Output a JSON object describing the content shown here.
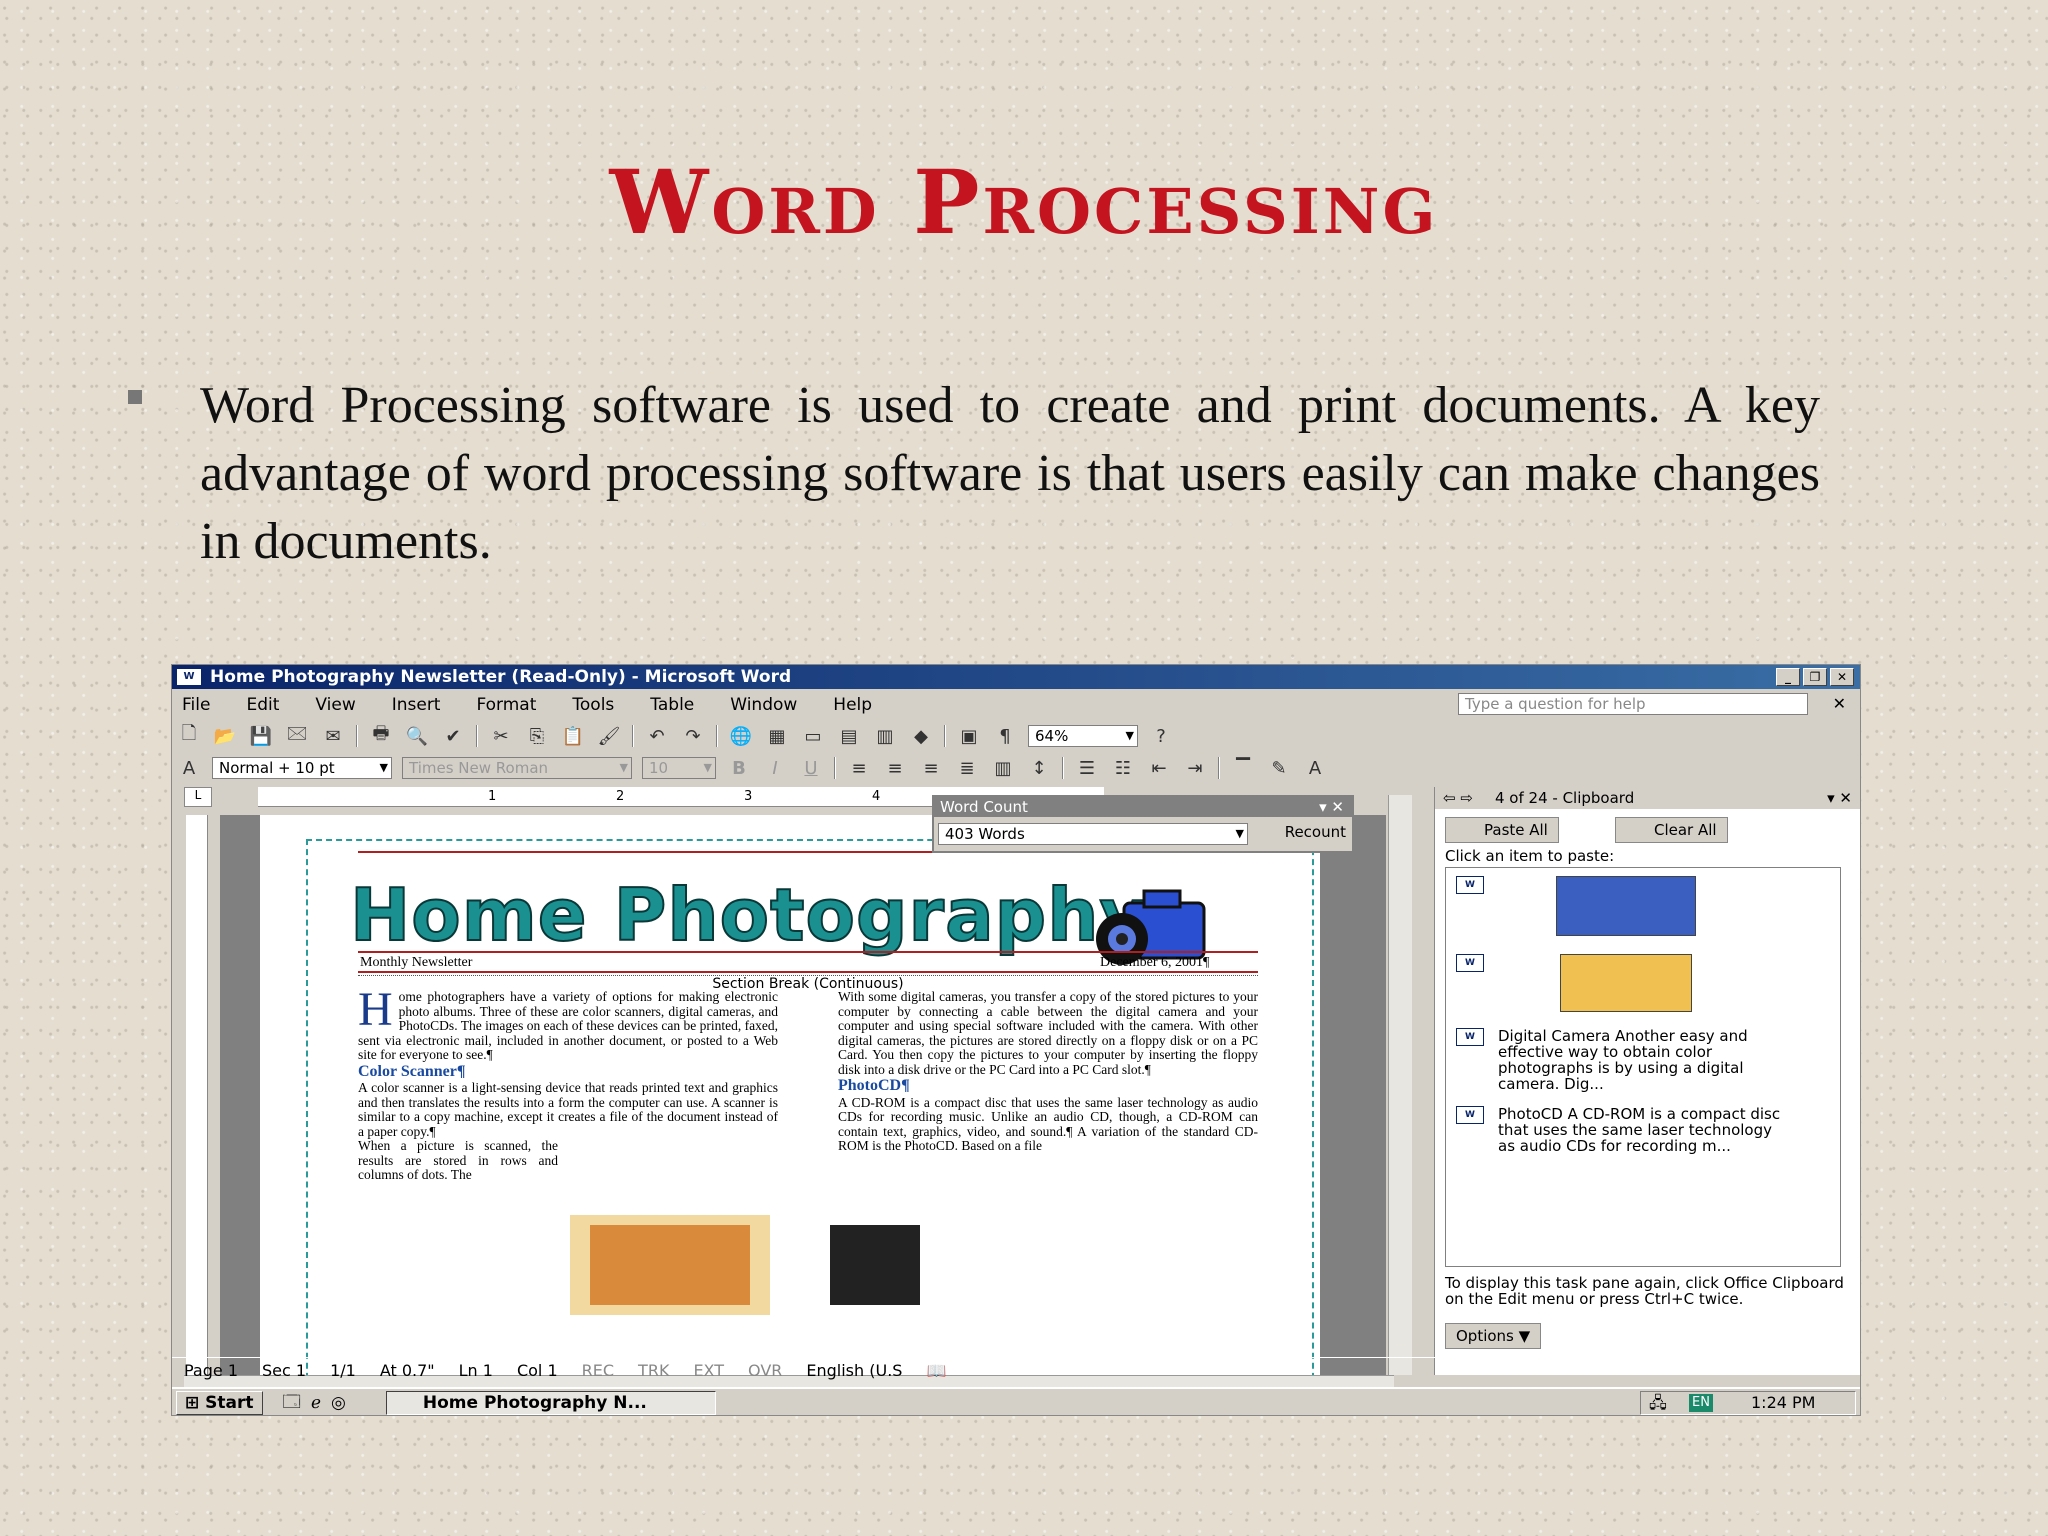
{
  "slide": {
    "title": "Word Processing",
    "bullet": "Word Processing software is used to create and print documents. A key advantage of word processing software is that users easily can make changes in documents."
  },
  "window": {
    "title": "Home Photography Newsletter (Read-Only) - Microsoft Word",
    "menu": [
      "File",
      "Edit",
      "View",
      "Insert",
      "Format",
      "Tools",
      "Table",
      "Window",
      "Help"
    ],
    "help_placeholder": "Type a question for help",
    "style_box": "Normal + 10 pt",
    "font_box": "Times New Roman",
    "size_box": "10",
    "zoom": "64%",
    "ruler_numbers": [
      "1",
      "2",
      "3",
      "4"
    ]
  },
  "word_count": {
    "title": "Word Count",
    "value": "403 Words",
    "recount": "Recount"
  },
  "document": {
    "masthead": "Home Photography",
    "subtitle_left": "Monthly Newsletter",
    "subtitle_right": "December 6, 2001¶",
    "section_break": "Section Break (Continuous)",
    "col1_dropcap": "H",
    "col1_p1": "ome photographers have a variety of options for making electronic photo albums. Three of these are color scanners, digital cameras, and PhotoCDs. The images on each of these devices can be printed, faxed, sent via electronic mail, included in another document, or posted to a Web site for everyone to see.¶",
    "col1_h1": "Color Scanner¶",
    "col1_p2": "A color scanner is a light-sensing device that reads printed text and graphics and then translates the results into a form the computer can use. A scanner is similar to a copy machine, except it creates a file of the document instead of a paper copy.¶",
    "col1_p3": "When a picture is scanned, the results are stored in rows and columns of dots. The",
    "col2_p1": "With some digital cameras, you transfer a copy of the stored pictures to your computer by connecting a cable between the digital camera and your computer and using special software included with the camera. With other digital cameras, the pictures are stored directly on a floppy disk or on a PC Card. You then copy the pictures to your computer by inserting the floppy disk into a disk drive or the PC Card into a PC Card slot.¶",
    "col2_h1": "PhotoCD¶",
    "col2_p2": "A CD-ROM is a compact disc that uses the same laser technology as audio CDs for recording music. Unlike an audio CD, though, a CD-ROM can contain text, graphics, video, and sound.¶ A variation of the standard CD-ROM is the PhotoCD. Based on a file"
  },
  "task_pane": {
    "title": "4 of 24 - Clipboard",
    "paste_all": "Paste All",
    "clear_all": "Clear All",
    "hint": "Click an item to paste:",
    "items": [
      "Digital Camera Another easy and effective way to obtain color photographs is by using a digital camera. Dig...",
      "PhotoCD A CD-ROM is a compact disc that uses the same laser technology as audio CDs for recording m..."
    ],
    "footer": "To display this task pane again, click Office Clipboard on the Edit menu or press Ctrl+C twice.",
    "options": "Options"
  },
  "status": {
    "page": "Page 1",
    "sec": "Sec 1",
    "count": "1/1",
    "at": "At 0.7\"",
    "ln": "Ln 1",
    "col": "Col 1",
    "rec": "REC",
    "trk": "TRK",
    "ext": "EXT",
    "ovr": "OVR",
    "lang": "English (U.S"
  },
  "taskbar": {
    "start": "Start",
    "task": "Home Photography N...",
    "lang": "EN",
    "time": "1:24 PM"
  },
  "colors": {
    "title": "#c41420",
    "titlebar": "#0a246a",
    "masthead": "#1a9090"
  }
}
